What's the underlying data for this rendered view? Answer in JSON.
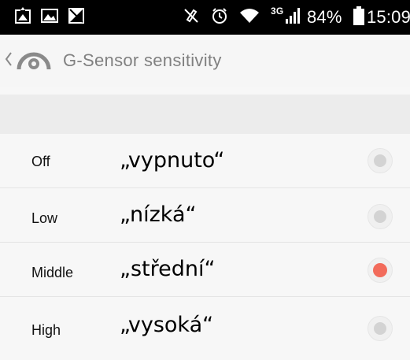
{
  "status_bar": {
    "network_type": "3G",
    "battery_percent": "84%",
    "time": "15:09",
    "icons": [
      "photo-upload-icon",
      "image-icon",
      "signal-off-icon",
      "mute-icon",
      "alarm-icon",
      "wifi-icon",
      "cell-signal-icon",
      "battery-icon"
    ]
  },
  "action_bar": {
    "back_icon": "chevron-left-icon",
    "app_icon": "speed-gauge-icon",
    "title": "G-Sensor sensitivity"
  },
  "options": [
    {
      "label": "Off",
      "annotation": "„vypnuto“",
      "selected": false
    },
    {
      "label": "Low",
      "annotation": "„nízká“",
      "selected": false
    },
    {
      "label": "Middle",
      "annotation": "„střední“",
      "selected": true
    },
    {
      "label": "High",
      "annotation": "„vysoká“",
      "selected": false
    }
  ],
  "colors": {
    "selected_radio": "#f26b5b",
    "unselected_radio": "#d3d3d3",
    "title_text": "#808080",
    "status_bar": "#000000"
  }
}
